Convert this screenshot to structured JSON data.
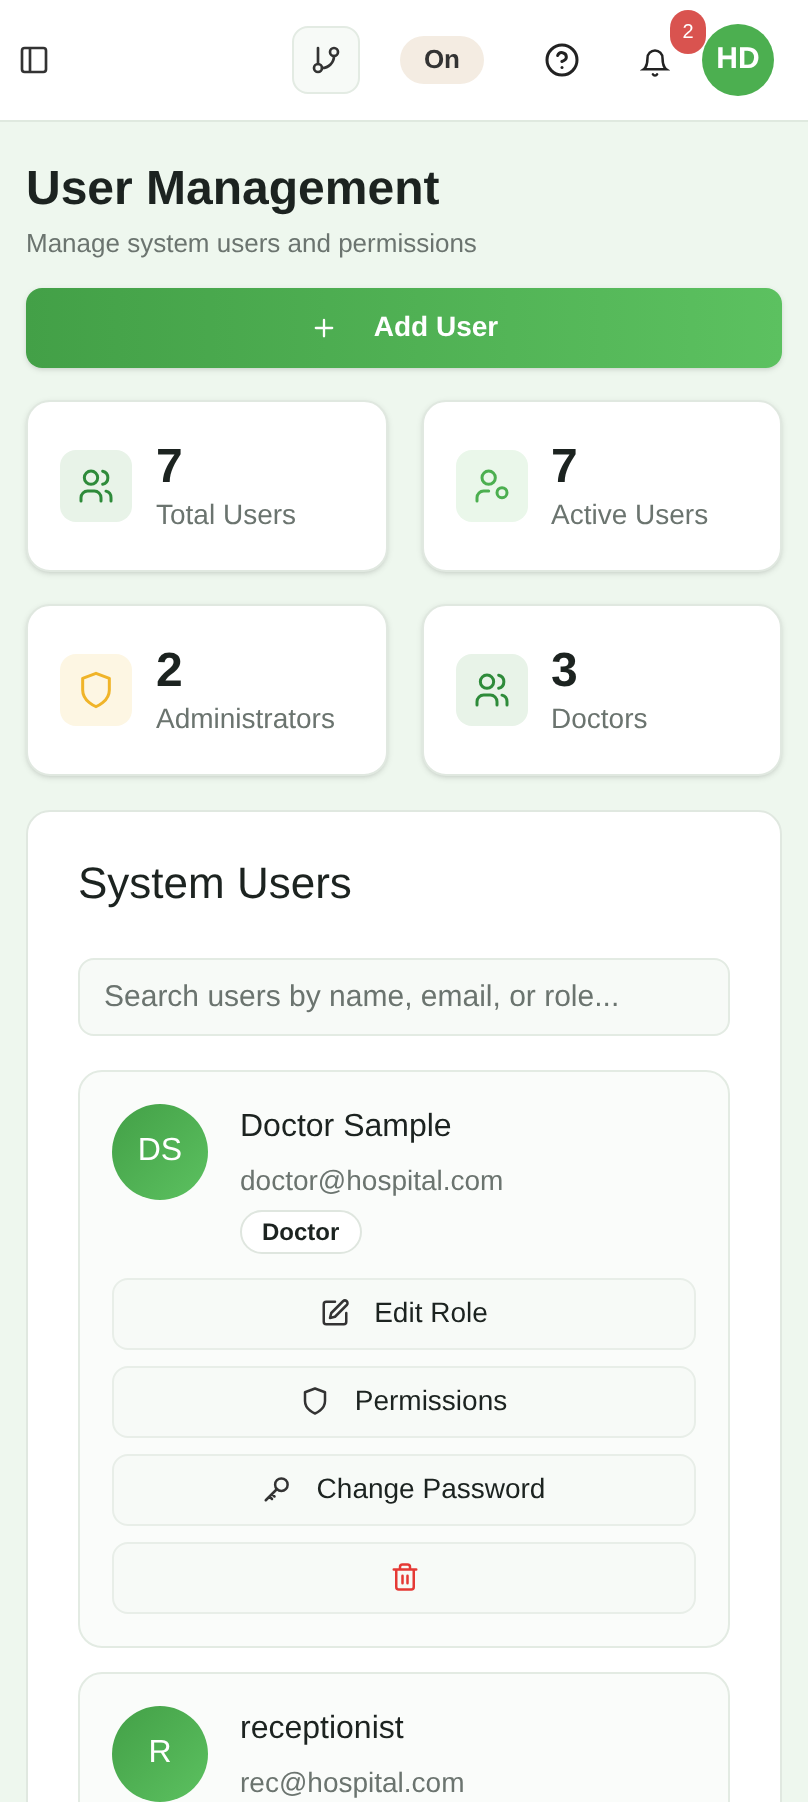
{
  "header": {
    "toggle_label": "On",
    "notification_count": "2",
    "avatar_initials": "HD"
  },
  "page": {
    "title": "User Management",
    "subtitle": "Manage system users and permissions",
    "add_button": "Add User"
  },
  "stats": [
    {
      "value": "7",
      "label": "Total Users",
      "kind": "users"
    },
    {
      "value": "7",
      "label": "Active Users",
      "kind": "user-gear"
    },
    {
      "value": "2",
      "label": "Administrators",
      "kind": "shield"
    },
    {
      "value": "3",
      "label": "Doctors",
      "kind": "users"
    }
  ],
  "users_panel": {
    "title": "System Users",
    "search": {
      "placeholder": "Search users by name, email, or role..."
    },
    "users": [
      {
        "initials": "DS",
        "name": "Doctor Sample",
        "email": "doctor@hospital.com",
        "role": "Doctor",
        "actions": [
          {
            "kind": "edit",
            "label": "Edit Role"
          },
          {
            "kind": "permissions",
            "label": "Permissions"
          },
          {
            "kind": "password",
            "label": "Change Password"
          },
          {
            "kind": "delete"
          }
        ]
      },
      {
        "initials": "R",
        "name": "receptionist",
        "email": "rec@hospital.com"
      }
    ]
  }
}
